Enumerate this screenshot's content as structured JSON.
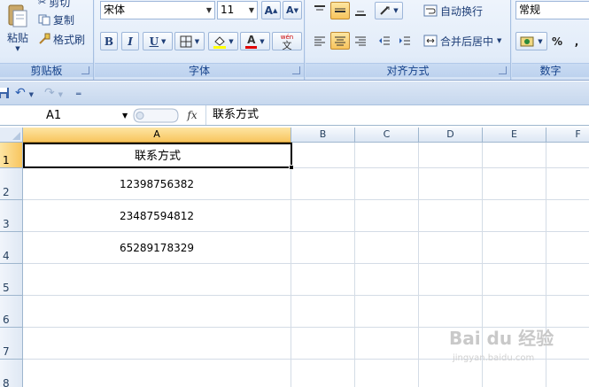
{
  "ribbon": {
    "clipboard": {
      "paste_label": "粘贴",
      "cut_label": "剪切",
      "copy_label": "复制",
      "format_painter_label": "格式刷",
      "group_label": "剪贴板"
    },
    "font": {
      "font_name": "宋体",
      "font_size": "11",
      "grow_label": "A",
      "shrink_label": "A",
      "bold_label": "B",
      "italic_label": "I",
      "underline_label": "U",
      "phonetic_label": "wén",
      "phonetic_glyph": "文",
      "color_letter": "A",
      "group_label": "字体"
    },
    "alignment": {
      "wrap_text_label": "自动换行",
      "merge_center_label": "合并后居中",
      "group_label": "对齐方式"
    },
    "number": {
      "format_value": "常规",
      "percent_label": "%",
      "comma_label": ",",
      "group_label": "数字"
    }
  },
  "formula_bar": {
    "name_box": "A1",
    "fx_label": "fx",
    "formula": "联系方式"
  },
  "sheet": {
    "columns": [
      "A",
      "B",
      "C",
      "D",
      "E",
      "F"
    ],
    "rows": [
      "1",
      "2",
      "3",
      "4",
      "5",
      "6",
      "7",
      "8"
    ],
    "cells": {
      "A1": "联系方式",
      "A2": "12398756382",
      "A3": "23487594812",
      "A4": "65289178329"
    },
    "active_cell": "A1"
  },
  "watermark": {
    "brand": "Bai du 经验",
    "url": "jingyan.baidu.com"
  },
  "colors": {
    "selection_header": "#f8c55e",
    "ribbon_text": "#15428b",
    "grid_line": "#d4dce6"
  }
}
